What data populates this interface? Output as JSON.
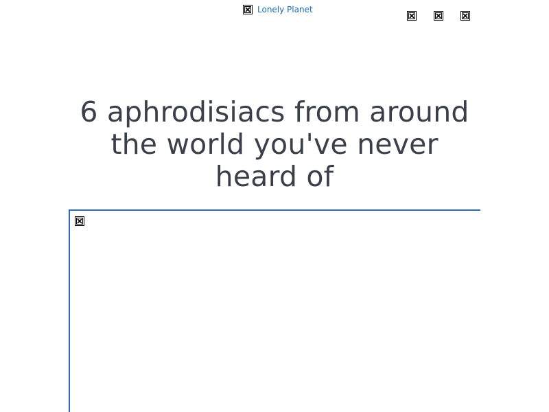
{
  "header": {
    "logo_text": "Lonely Planet",
    "logo_icon": "broken-image-icon",
    "action_icons": [
      "broken-image-icon",
      "broken-image-icon",
      "broken-image-icon"
    ]
  },
  "article": {
    "title": "6 aphrodisiacs from around the world you've never heard of",
    "hero_icon": "broken-image-icon"
  },
  "colors": {
    "link": "#1a6cb7",
    "title": "#3a3f4a",
    "frame_border": "#2b6cb0"
  }
}
